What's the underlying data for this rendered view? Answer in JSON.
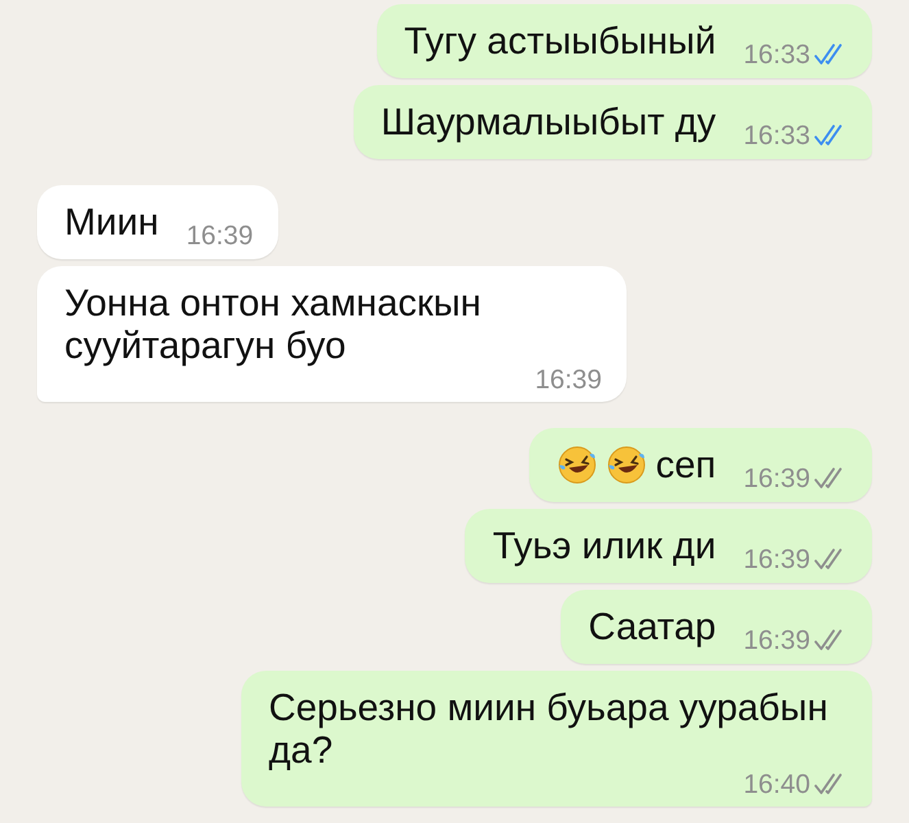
{
  "messages": [
    {
      "outgoing": true,
      "text": "Тугу астыыбыный",
      "time": "16:33",
      "read": true,
      "tail": false
    },
    {
      "outgoing": true,
      "text": "Шаурмалыыбыт ду",
      "time": "16:33",
      "read": true,
      "tail": true
    },
    {
      "outgoing": false,
      "text": "Миин",
      "time": "16:39",
      "tail": false
    },
    {
      "outgoing": false,
      "text": "Уонна онтон хамнаскын сууйтарагун буо",
      "time": "16:39",
      "tail": true
    },
    {
      "outgoing": true,
      "icons": [
        {
          "kind": "laughing"
        },
        {
          "kind": "laughing"
        }
      ],
      "text": "сеп",
      "time": "16:39",
      "read": false,
      "tail": false
    },
    {
      "outgoing": true,
      "text": "Туьэ илик ди",
      "time": "16:39",
      "read": false,
      "tail": false
    },
    {
      "outgoing": true,
      "text": "Саатар",
      "time": "16:39",
      "read": false,
      "tail": false
    },
    {
      "outgoing": true,
      "text": "Серьезно миин буьара уурабын да?",
      "time": "16:40",
      "read": false,
      "tail": true
    }
  ]
}
